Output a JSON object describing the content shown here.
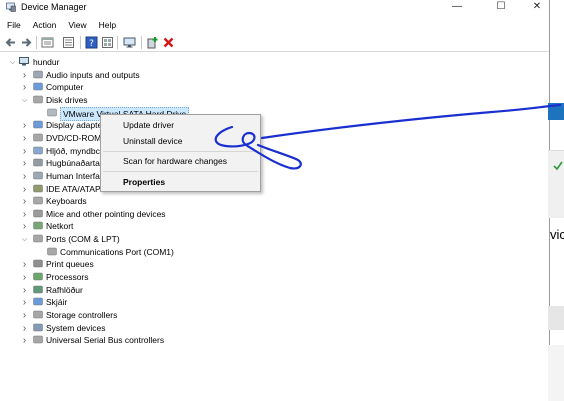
{
  "window": {
    "title": "Device Manager",
    "controls": {
      "minimize": "—",
      "maximize": "☐",
      "close": "✕"
    }
  },
  "menu": [
    "File",
    "Action",
    "View",
    "Help"
  ],
  "toolbar": [
    "back-arrow-icon",
    "forward-arrow-icon",
    "properties-icon",
    "view-icon",
    "help-icon",
    "display-icon",
    "enable-device-icon",
    "uninstall-x-icon"
  ],
  "tree": {
    "root": "hundur",
    "items": [
      {
        "label": "Audio inputs and outputs",
        "expanded": false
      },
      {
        "label": "Computer",
        "expanded": false
      },
      {
        "label": "Disk drives",
        "expanded": true
      },
      {
        "label": "VMware Virtual SATA Hard Drive",
        "child": true,
        "selected": true
      },
      {
        "label": "Display adapte",
        "expanded": false
      },
      {
        "label": "DVD/CD-ROM",
        "expanded": false
      },
      {
        "label": "Hljóð, myndbc",
        "expanded": false
      },
      {
        "label": "Hugbúnaðarta",
        "expanded": false
      },
      {
        "label": "Human Interfa",
        "expanded": false
      },
      {
        "label": "IDE ATA/ATAPI controllers",
        "expanded": false
      },
      {
        "label": "Keyboards",
        "expanded": false
      },
      {
        "label": "Mice and other pointing devices",
        "expanded": false
      },
      {
        "label": "Netkort",
        "expanded": false
      },
      {
        "label": "Ports (COM & LPT)",
        "expanded": true
      },
      {
        "label": "Communications Port (COM1)",
        "child": true
      },
      {
        "label": "Print queues",
        "expanded": false
      },
      {
        "label": "Processors",
        "expanded": false
      },
      {
        "label": "Rafhlöður",
        "expanded": false
      },
      {
        "label": "Skjáir",
        "expanded": false
      },
      {
        "label": "Storage controllers",
        "expanded": false
      },
      {
        "label": "System devices",
        "expanded": false
      },
      {
        "label": "Universal Serial Bus controllers",
        "expanded": false
      }
    ]
  },
  "context_menu": {
    "update_driver": "Update driver",
    "uninstall_device": "Uninstall device",
    "scan": "Scan for hardware changes",
    "properties": "Properties"
  },
  "background_fragment": "vic",
  "colors": {
    "selection": "#cce8ff",
    "ink": "#1a2fd0",
    "accent_blue": "#1e73be"
  }
}
